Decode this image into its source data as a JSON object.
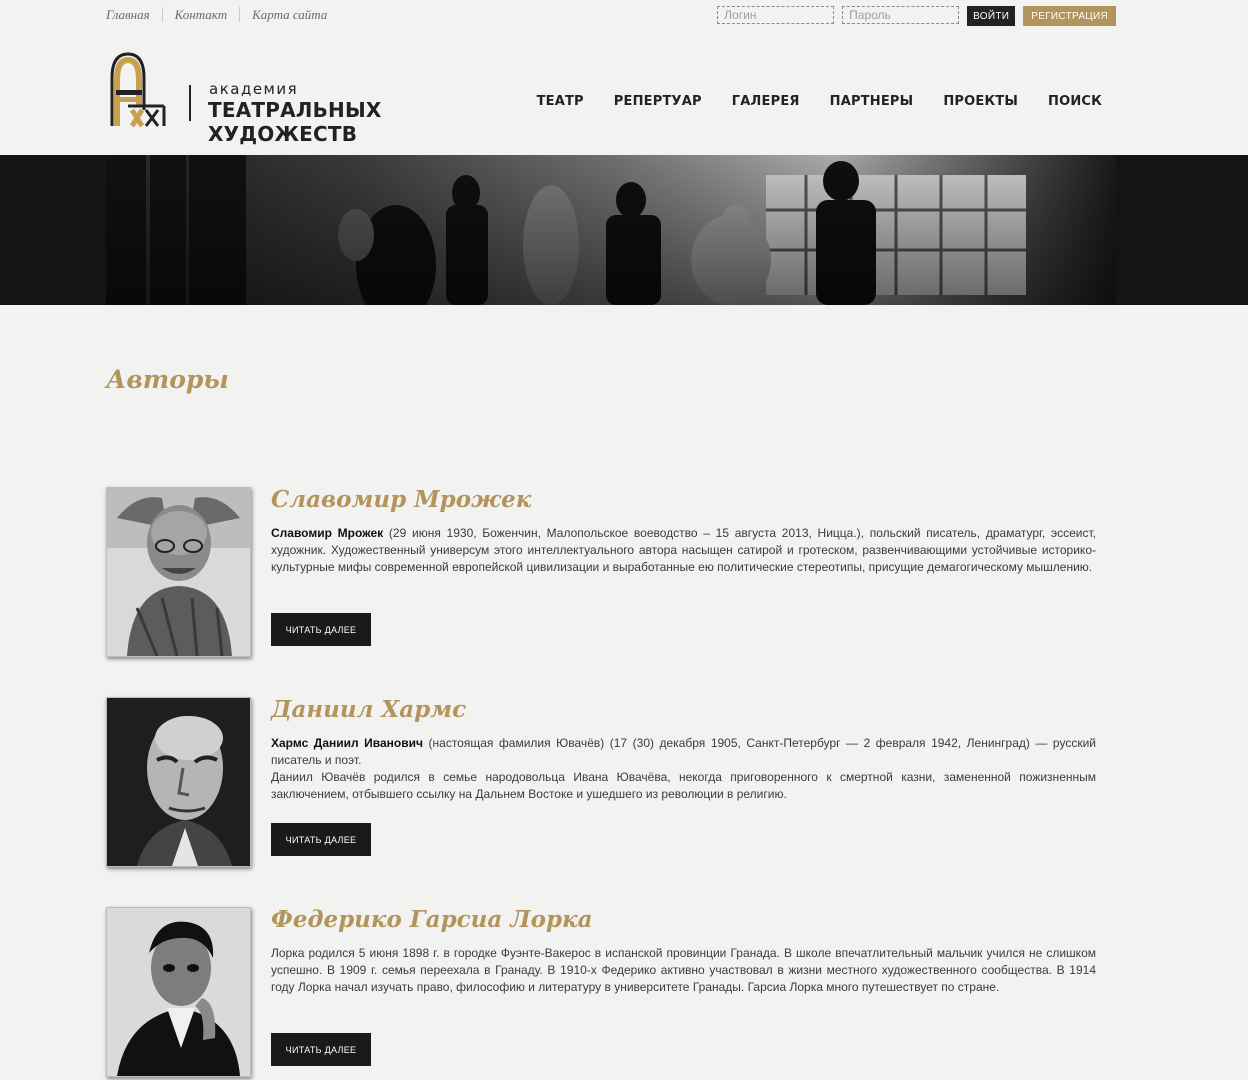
{
  "toplinks": [
    "Главная",
    "Контакт",
    "Карта сайта"
  ],
  "login": {
    "login_placeholder": "Логин",
    "password_placeholder": "Пароль",
    "login_button": "ВОЙТИ",
    "register_button": "РЕГИСТРАЦИЯ"
  },
  "logo": {
    "small": "академия",
    "big": "ТЕАТРАЛЬНЫХ ХУДОЖЕСТВ"
  },
  "nav": [
    "ТЕАТР",
    "РЕПЕРТУАР",
    "ГАЛЕРЕЯ",
    "ПАРТНЕРЫ",
    "ПРОЕКТЫ",
    "ПОИСК"
  ],
  "page_title": "Авторы",
  "read_more": "ЧИТАТЬ ДАЛЕЕ",
  "authors": [
    {
      "name": "Славомир Мрожек",
      "bold": "Славомир Мрожек",
      "text": " (29 июня 1930, Боженчин, Малопольское воеводство – 15 августа 2013, Ницца.), польский писатель, драматург, эссеист, художник. Художественный универсум этого интеллектуального автора насыщен сатирой и гротеском, развенчивающими устойчивые историко-культурные мифы современной европейской цивилизации и выработанные ею политические стереотипы, присущие демагогическому мышлению.",
      "text2": ""
    },
    {
      "name": "Даниил Хармс",
      "bold": "Хармс Даниил Иванович",
      "text": " (настоящая фамилия Ювачёв) (17 (30) декабря 1905, Санкт-Петербург — 2 февраля 1942, Ленинград) — русский писатель и поэт.",
      "text2": "Даниил Ювачёв родился в семье народовольца Ивана Ювачёва, некогда приговоренного к смертной казни, замененной пожизненным заключением, отбывшего ссылку на Дальнем Востоке и ушедшего из революции в религию."
    },
    {
      "name": "Федерико Гарсиа Лорка",
      "bold": "",
      "text": "Лорка родился 5 июня 1898 г. в городке Фуэнте-Вакерос в испанской провинции Гранада. В школе впечатлительный мальчик учился не слишком успешно. В 1909 г. семья переехала в Гранаду. В 1910-х Федерико активно участвовал в жизни местного художественного сообщества. В 1914 году Лорка начал изучать право, философию и литературу в университете Гранады. Гарсиа Лорка много путешествует по стране.",
      "text2": ""
    }
  ],
  "colors": {
    "accent": "#b3955c",
    "dark": "#1a1a1a",
    "background": "#f2f2f1"
  }
}
